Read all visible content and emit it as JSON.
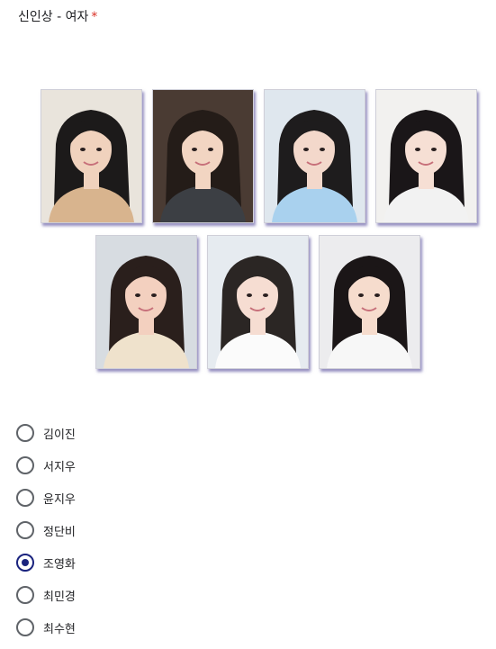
{
  "question": {
    "title": "신인상 - 여자",
    "required_mark": "*"
  },
  "photos": [
    {
      "name": "photo-1",
      "bg": "#e9e4dc",
      "hair": "#1c1a1a",
      "skin": "#f0d2bd",
      "shirt": "#d8b48e"
    },
    {
      "name": "photo-2",
      "bg": "#4a3b33",
      "hair": "#241c18",
      "skin": "#f2d5c2",
      "shirt": "#3c3f44"
    },
    {
      "name": "photo-3",
      "bg": "#dfe7ee",
      "hair": "#1e1c1d",
      "skin": "#f3d8cb",
      "shirt": "#a9d1ee"
    },
    {
      "name": "photo-4",
      "bg": "#f2f1ef",
      "hair": "#1a1618",
      "skin": "#f6dfd4",
      "shirt": "#f2f2f2"
    },
    {
      "name": "photo-5",
      "bg": "#d7dce1",
      "hair": "#2a1f1c",
      "skin": "#f3d0bf",
      "shirt": "#efe2cc"
    },
    {
      "name": "photo-6",
      "bg": "#e6ebf0",
      "hair": "#2b2624",
      "skin": "#f6ddd2",
      "shirt": "#fbfbfb"
    },
    {
      "name": "photo-7",
      "bg": "#ececee",
      "hair": "#1b1617",
      "skin": "#f6dccd",
      "shirt": "#f7f7f7"
    }
  ],
  "options": [
    {
      "label": "김이진",
      "checked": false
    },
    {
      "label": "서지우",
      "checked": false
    },
    {
      "label": "윤지우",
      "checked": false
    },
    {
      "label": "정단비",
      "checked": false
    },
    {
      "label": "조영화",
      "checked": true
    },
    {
      "label": "최민경",
      "checked": false
    },
    {
      "label": "최수현",
      "checked": false
    }
  ],
  "colors": {
    "accent": "#1a237e",
    "required": "#d93025",
    "text": "#202124"
  }
}
